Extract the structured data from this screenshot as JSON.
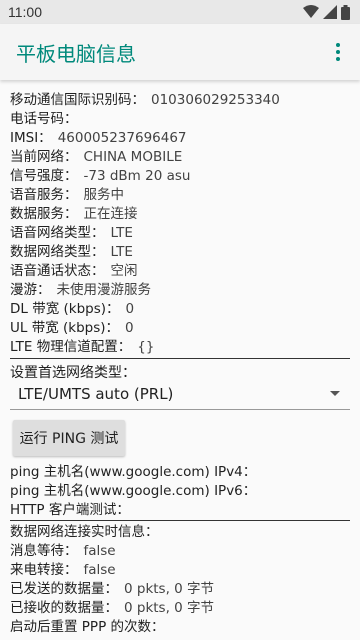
{
  "status_bar": {
    "time": "11:00",
    "icons": [
      "wifi-icon",
      "signal-icon",
      "battery-icon"
    ]
  },
  "app_bar": {
    "title": "平板电脑信息",
    "overflow_icon": "more-vert-icon"
  },
  "info_rows": [
    {
      "label": "移动通信国际识别码：",
      "value": "010306029253340"
    },
    {
      "label": "电话号码：",
      "value": ""
    },
    {
      "label": "IMSI：",
      "value": "460005237696467"
    },
    {
      "label": "当前网络：",
      "value": "CHINA MOBILE"
    },
    {
      "label": "信号强度：",
      "value": "-73 dBm   20 asu"
    },
    {
      "label": "语音服务：",
      "value": "服务中"
    },
    {
      "label": "数据服务：",
      "value": "正在连接"
    },
    {
      "label": "语音网络类型：",
      "value": "LTE"
    },
    {
      "label": "数据网络类型：",
      "value": "LTE"
    },
    {
      "label": "语音通话状态：",
      "value": "空闲"
    },
    {
      "label": "漫游：",
      "value": "未使用漫游服务"
    },
    {
      "label": "DL 带宽 (kbps)：",
      "value": "0"
    },
    {
      "label": "UL 带宽 (kbps)：",
      "value": "0"
    },
    {
      "label": "LTE 物理信道配置：",
      "value": "{}"
    }
  ],
  "network_type": {
    "label": "设置首选网络类型：",
    "selected": "LTE/UMTS auto (PRL)"
  },
  "ping_button": {
    "label": "运行 PING 测试"
  },
  "ping_rows": [
    {
      "label": "ping 主机名(www.google.com) IPv4：",
      "value": ""
    },
    {
      "label": "ping 主机名(www.google.com) IPv6：",
      "value": ""
    },
    {
      "label": "HTTP 客户端测试：",
      "value": ""
    }
  ],
  "data_rows": [
    {
      "label": "数据网络连接实时信息：",
      "value": ""
    },
    {
      "label": "消息等待：",
      "value": "false"
    },
    {
      "label": "来电转接：",
      "value": "false"
    },
    {
      "label": "已发送的数据量：",
      "value": "0 pkts, 0 字节"
    },
    {
      "label": "已接收的数据量：",
      "value": "0 pkts, 0 字节"
    },
    {
      "label": "启动后重置 PPP 的次数：",
      "value": ""
    }
  ]
}
